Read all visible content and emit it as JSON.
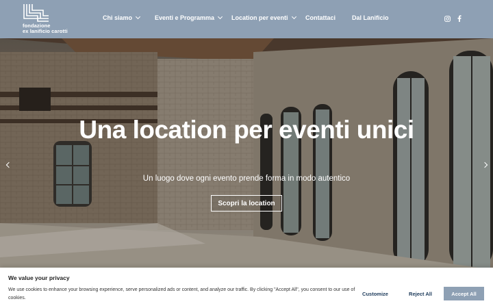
{
  "header": {
    "logo_lines": [
      "fondazione",
      "ex lanificio carotti"
    ],
    "nav": [
      {
        "label": "Chi siamo",
        "dropdown": true
      },
      {
        "label": "Eventi e Programma",
        "dropdown": true
      },
      {
        "label": "Location per eventi",
        "dropdown": true
      },
      {
        "label": "Contattaci",
        "dropdown": false
      },
      {
        "label": "Dal Lanificio",
        "dropdown": false
      }
    ],
    "social": [
      "instagram-icon",
      "facebook-icon"
    ],
    "bg_color": "#8ea0b4"
  },
  "hero": {
    "title": "Una location per eventi unici",
    "subtitle": "Un luogo dove ogni evento prende forma in modo autentico",
    "cta_label": "Scopri la location"
  },
  "cookie": {
    "title": "We value your privacy",
    "text": "We use cookies to enhance your browsing experience, serve personalized ads or content, and analyze our traffic. By clicking \"Accept All\", you consent to our use of cookies.",
    "customize_label": "Customize",
    "reject_label": "Reject All",
    "accept_label": "Accept All",
    "accent_color": "#8ea0b4"
  }
}
